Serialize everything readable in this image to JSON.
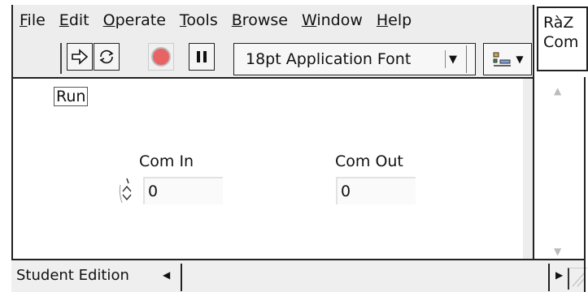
{
  "menubar": {
    "items": [
      {
        "u": "F",
        "rest": "ile"
      },
      {
        "u": "E",
        "rest": "dit"
      },
      {
        "u": "O",
        "rest": "perate"
      },
      {
        "u": "T",
        "rest": "ools"
      },
      {
        "u": "B",
        "rest": "rowse"
      },
      {
        "u": "W",
        "rest": "indow"
      },
      {
        "u": "H",
        "rest": "elp"
      }
    ]
  },
  "toolbar": {
    "run_icon": "run-arrow-icon",
    "run_continuously_icon": "run-continuously-icon",
    "abort_icon": "abort-stop-icon",
    "pause_icon": "pause-icon",
    "font_label": "18pt Application Font",
    "abort_color": "#e86464"
  },
  "panel": {
    "run_label": "Run",
    "com_in_label": "Com In",
    "com_in_value": "0",
    "com_out_label": "Com Out",
    "com_out_value": "0"
  },
  "statusbar": {
    "label": "Student Edition"
  },
  "sidepanel": {
    "line1": "RàZ",
    "line2": "Com"
  }
}
